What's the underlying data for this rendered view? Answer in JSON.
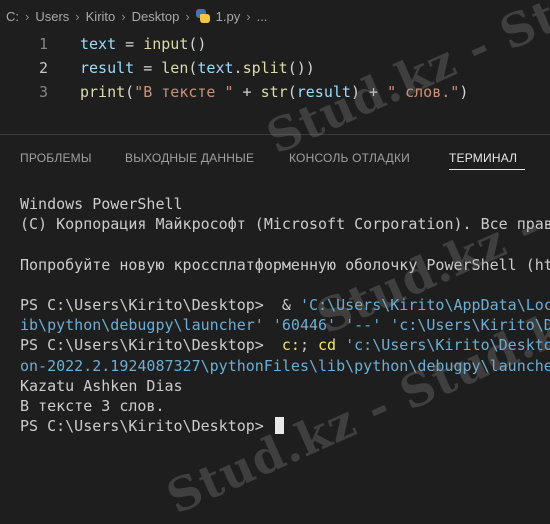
{
  "breadcrumb": {
    "items": [
      "C:",
      "Users",
      "Kirito",
      "Desktop",
      "1.py"
    ],
    "ellipsis": "...",
    "separator": "›"
  },
  "editor": {
    "lines": [
      {
        "number": "1",
        "tokens": [
          {
            "t": "text",
            "c": "v"
          },
          {
            "t": " = ",
            "c": "p"
          },
          {
            "t": "input",
            "c": "f"
          },
          {
            "t": "()",
            "c": "p"
          }
        ]
      },
      {
        "number": "2",
        "tokens": [
          {
            "t": "result",
            "c": "v"
          },
          {
            "t": " = ",
            "c": "p"
          },
          {
            "t": "len",
            "c": "f"
          },
          {
            "t": "(",
            "c": "p"
          },
          {
            "t": "text",
            "c": "v"
          },
          {
            "t": ".",
            "c": "p"
          },
          {
            "t": "split",
            "c": "f"
          },
          {
            "t": "())",
            "c": "p"
          }
        ]
      },
      {
        "number": "3",
        "tokens": [
          {
            "t": "print",
            "c": "f"
          },
          {
            "t": "(",
            "c": "p"
          },
          {
            "t": "\"В тексте \"",
            "c": "s"
          },
          {
            "t": " + ",
            "c": "p"
          },
          {
            "t": "str",
            "c": "f"
          },
          {
            "t": "(",
            "c": "p"
          },
          {
            "t": "result",
            "c": "v"
          },
          {
            "t": ") + ",
            "c": "p"
          },
          {
            "t": "\" слов.\"",
            "c": "s"
          },
          {
            "t": ")",
            "c": "p"
          }
        ]
      }
    ],
    "active_line": 2
  },
  "panel": {
    "tabs": [
      "ПРОБЛЕМЫ",
      "ВЫХОДНЫЕ ДАННЫЕ",
      "КОНСОЛЬ ОТЛАДКИ",
      "ТЕРМИНАЛ"
    ],
    "active_tab": "ТЕРМИНАЛ"
  },
  "terminal": {
    "lines": [
      [
        {
          "t": "Windows PowerShell"
        }
      ],
      [
        {
          "t": "(C) Корпорация Майкрософт (Microsoft Corporation). Все прав"
        }
      ],
      [],
      [
        {
          "t": "Попробуйте новую кроссплатформенную оболочку PowerShell (ht"
        }
      ],
      [],
      [
        {
          "t": "PS C:\\Users\\Kirito\\Desktop>  & "
        },
        {
          "t": "'C:\\Users\\Kirito\\AppData\\Loc",
          "c": "t-str"
        }
      ],
      [
        {
          "t": "ib\\python\\debugpy\\launcher'",
          "c": "t-str"
        },
        {
          "t": " "
        },
        {
          "t": "'60446'",
          "c": "t-str"
        },
        {
          "t": " "
        },
        {
          "t": "'--'",
          "c": "t-str"
        },
        {
          "t": " "
        },
        {
          "t": "'c:\\Users\\Kirito\\D",
          "c": "t-str"
        }
      ],
      [
        {
          "t": "PS C:\\Users\\Kirito\\Desktop>  "
        },
        {
          "t": "c:",
          "c": "t-cmd"
        },
        {
          "t": "; "
        },
        {
          "t": "cd",
          "c": "t-cmd"
        },
        {
          "t": " "
        },
        {
          "t": "'c:\\Users\\Kirito\\Deskto",
          "c": "t-str"
        }
      ],
      [
        {
          "t": "on-2022.2.1924087327\\pythonFiles\\lib\\python\\debugpy\\launche",
          "c": "t-str"
        }
      ],
      [
        {
          "t": "Kazatu Ashken Dias"
        }
      ],
      [
        {
          "t": "В тексте 3 слов."
        }
      ],
      [
        {
          "t": "PS C:\\Users\\Kirito\\Desktop> "
        }
      ]
    ]
  },
  "watermark": "Stud.kz - Stud.kz",
  "colors": {
    "background": "#1e1e1e",
    "keyword_var": "#9cdcfe",
    "function": "#dcdcaa",
    "string": "#ce9178",
    "terminal_string": "#6caed4",
    "terminal_cmd": "#f0e46a"
  }
}
